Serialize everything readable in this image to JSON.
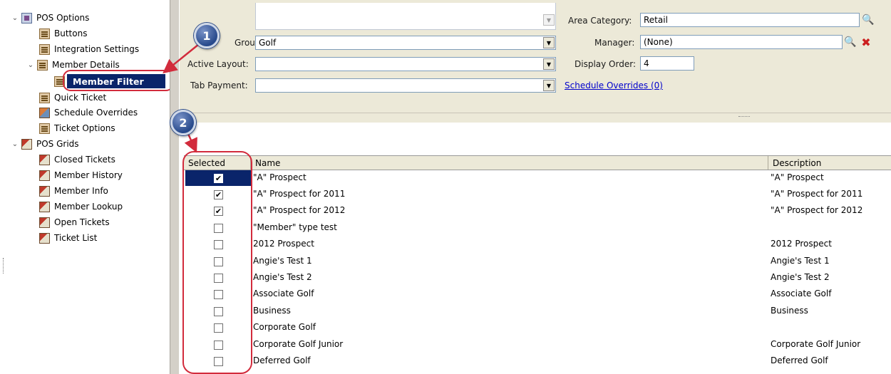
{
  "tree": {
    "items": [
      {
        "label": "POS Options"
      },
      {
        "label": "Buttons"
      },
      {
        "label": "Integration Settings"
      },
      {
        "label": "Member Details"
      },
      {
        "label": "Member Filter"
      },
      {
        "label": "Quick Ticket"
      },
      {
        "label": "Schedule Overrides"
      },
      {
        "label": "Ticket Options"
      },
      {
        "label": "POS Grids"
      },
      {
        "label": "Closed Tickets"
      },
      {
        "label": "Member History"
      },
      {
        "label": "Member Info"
      },
      {
        "label": "Member Lookup"
      },
      {
        "label": "Open Tickets"
      },
      {
        "label": "Ticket List"
      }
    ]
  },
  "form": {
    "group_label": "Group:",
    "group_value": "Golf",
    "active_layout_label": "Active Layout:",
    "active_layout_value": "",
    "tab_payment_label": "Tab Payment:",
    "tab_payment_value": "",
    "area_category_label": "Area Category:",
    "area_category_value": "Retail",
    "manager_label": "Manager:",
    "manager_value": "(None)",
    "display_order_label": "Display Order:",
    "display_order_value": "4",
    "schedule_overrides_link": "Schedule Overrides (0)"
  },
  "grid": {
    "columns": [
      "Selected",
      "Name",
      "Description"
    ],
    "rows": [
      {
        "checked": "✔",
        "name": "\"A\" Prospect",
        "description": "\"A\" Prospect"
      },
      {
        "checked": "✔",
        "name": "\"A\" Prospect for 2011",
        "description": "\"A\" Prospect for 2011"
      },
      {
        "checked": "✔",
        "name": "\"A\" Prospect for 2012",
        "description": "\"A\" Prospect for 2012"
      },
      {
        "checked": "",
        "name": "\"Member\" type test",
        "description": ""
      },
      {
        "checked": "",
        "name": "2012 Prospect",
        "description": "2012 Prospect"
      },
      {
        "checked": "",
        "name": "Angie's Test 1",
        "description": "Angie's Test 1"
      },
      {
        "checked": "",
        "name": "Angie's Test 2",
        "description": "Angie's Test 2"
      },
      {
        "checked": "",
        "name": "Associate Golf",
        "description": "Associate Golf"
      },
      {
        "checked": "",
        "name": "Business",
        "description": "Business"
      },
      {
        "checked": "",
        "name": "Corporate Golf",
        "description": ""
      },
      {
        "checked": "",
        "name": "Corporate Golf Junior",
        "description": "Corporate Golf Junior"
      },
      {
        "checked": "",
        "name": "Deferred Golf",
        "description": "Deferred Golf"
      }
    ]
  },
  "callouts": [
    "1",
    "2"
  ],
  "colors": {
    "selection": "#0a246a",
    "annotation": "#d22b3c",
    "callout": "#284a8c"
  }
}
